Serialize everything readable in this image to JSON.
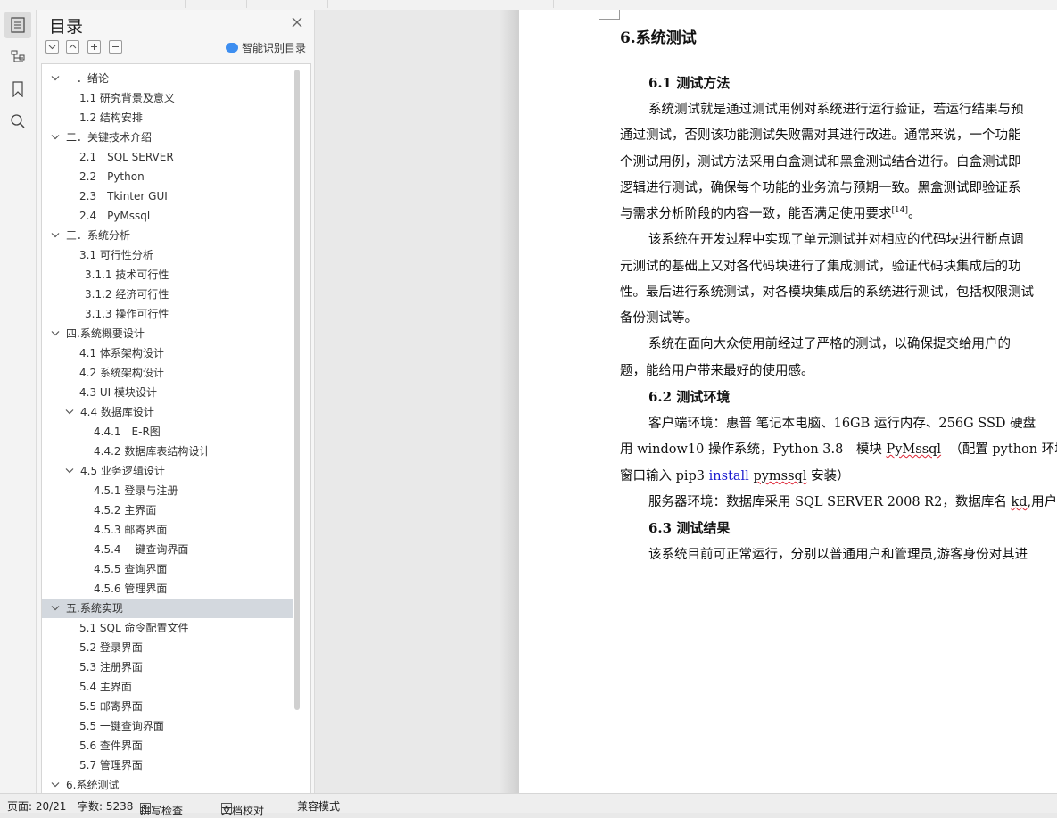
{
  "toc": {
    "title": "目录",
    "smart_label": "智能识别目录",
    "items": [
      {
        "label": "一．绪论",
        "caret": "down",
        "level": 0
      },
      {
        "label": "1.1 研究背景及意义",
        "caret": "",
        "level": 1
      },
      {
        "label": "1.2 结构安排",
        "caret": "",
        "level": 1
      },
      {
        "label": "二．关键技术介绍",
        "caret": "down",
        "level": 0
      },
      {
        "label": "2.1　SQL SERVER",
        "caret": "",
        "level": 1
      },
      {
        "label": "2.2　Python",
        "caret": "",
        "level": 1
      },
      {
        "label": "2.3　Tkinter GUI",
        "caret": "",
        "level": 1
      },
      {
        "label": "2.4　PyMssql",
        "caret": "",
        "level": 1
      },
      {
        "label": "三．系统分析",
        "caret": "down",
        "level": 0
      },
      {
        "label": "3.1 可行性分析",
        "caret": "",
        "level": 1
      },
      {
        "label": "3.1.1 技术可行性",
        "caret": "",
        "level": 1.5
      },
      {
        "label": "3.1.2 经济可行性",
        "caret": "",
        "level": 1.5
      },
      {
        "label": "3.1.3 操作可行性",
        "caret": "",
        "level": 1.5
      },
      {
        "label": "四.系统概要设计",
        "caret": "down",
        "level": 0
      },
      {
        "label": "4.1 体系架构设计",
        "caret": "",
        "level": 1
      },
      {
        "label": "4.2 系统架构设计",
        "caret": "",
        "level": 1
      },
      {
        "label": "4.3 UI 模块设计",
        "caret": "",
        "level": 1
      },
      {
        "label": "4.4  数据库设计",
        "caret": "down",
        "level": 1
      },
      {
        "label": "4.4.1　E-R图",
        "caret": "",
        "level": 2
      },
      {
        "label": "4.4.2  数据库表结构设计",
        "caret": "",
        "level": 2
      },
      {
        "label": "4.5 业务逻辑设计",
        "caret": "down",
        "level": 1
      },
      {
        "label": "4.5.1 登录与注册",
        "caret": "",
        "level": 2
      },
      {
        "label": "4.5.2 主界面",
        "caret": "",
        "level": 2
      },
      {
        "label": "4.5.3 邮寄界面",
        "caret": "",
        "level": 2
      },
      {
        "label": "4.5.4  一键查询界面",
        "caret": "",
        "level": 2
      },
      {
        "label": "4.5.5  查询界面",
        "caret": "",
        "level": 2
      },
      {
        "label": "4.5.6 管理界面",
        "caret": "",
        "level": 2
      },
      {
        "label": "五.系统实现",
        "caret": "down",
        "level": 0,
        "selected": true
      },
      {
        "label": "5.1 SQL  命令配置文件",
        "caret": "",
        "level": 1
      },
      {
        "label": "5.2  登录界面",
        "caret": "",
        "level": 1
      },
      {
        "label": "5.3  注册界面",
        "caret": "",
        "level": 1
      },
      {
        "label": "5.4  主界面",
        "caret": "",
        "level": 1
      },
      {
        "label": "5.5  邮寄界面",
        "caret": "",
        "level": 1
      },
      {
        "label": "5.5  一键查询界面",
        "caret": "",
        "level": 1
      },
      {
        "label": "5.6  查件界面",
        "caret": "",
        "level": 1
      },
      {
        "label": "5.7  管理界面",
        "caret": "",
        "level": 1
      },
      {
        "label": "6.系统测试",
        "caret": "down",
        "level": 0
      }
    ]
  },
  "document": {
    "heading": "6.系统测试",
    "sec1_title": "6.1 测试方法",
    "p1": [
      "系统测试就是通过测试用例对系统进行运行验证，若运行结果与预",
      "通过测试，否则该功能测试失败需对其进行改进。通常来说，一个功能",
      "个测试用例，测试方法采用白盒测试和黑盒测试结合进行。白盒测试即",
      "逻辑进行测试，确保每个功能的业务流与预期一致。黑盒测试即验证系",
      "与需求分析阶段的内容一致，能否满足使用要求"
    ],
    "cite": "[14]",
    "p1_end": "。",
    "p2": [
      "该系统在开发过程中实现了单元测试并对相应的代码块进行断点调",
      "元测试的基础上又对各代码块进行了集成测试，验证代码块集成后的功",
      "性。最后进行系统测试，对各模块集成后的系统进行测试，包括权限测试",
      "备份测试等。"
    ],
    "p3": [
      "系统在面向大众使用前经过了严格的测试，以确保提交给用户的",
      "题，能给用户带来最好的使用感。"
    ],
    "sec2_title": "6.2 测试环境",
    "env1": "客户端环境：惠普  笔记本电脑、16GB 运行内存、256G SSD 硬盘",
    "env2a": "用 window10 操作系统，Python 3.8　模块 ",
    "env2b": "PyMssql",
    "env2c": "（配置 python 环境变",
    "env3a": "窗口输入 pip3 ",
    "env3b": "install",
    "env3c": " ",
    "env3d": "pymssql",
    "env3e": " 安装）",
    "env4a": "服务器环境：数据库采用 SQL SERVER 2008 R2，数据库名 ",
    "env4b": "kd",
    "env4c": ",用户",
    "sec3_title": "6.3 测试结果",
    "result": "该系统目前可正常运行，分别以普通用户和管理员,游客身份对其进"
  },
  "status": {
    "page": "页面: 20/21",
    "words": "字数: 5238",
    "spell": "拼写检查",
    "proof": "文档校对",
    "compat": "兼容模式"
  },
  "colors": {
    "selected_row": "#d3d8de",
    "link_blue": "#1a1ad0",
    "ai_blue": "#3d8ef0"
  }
}
